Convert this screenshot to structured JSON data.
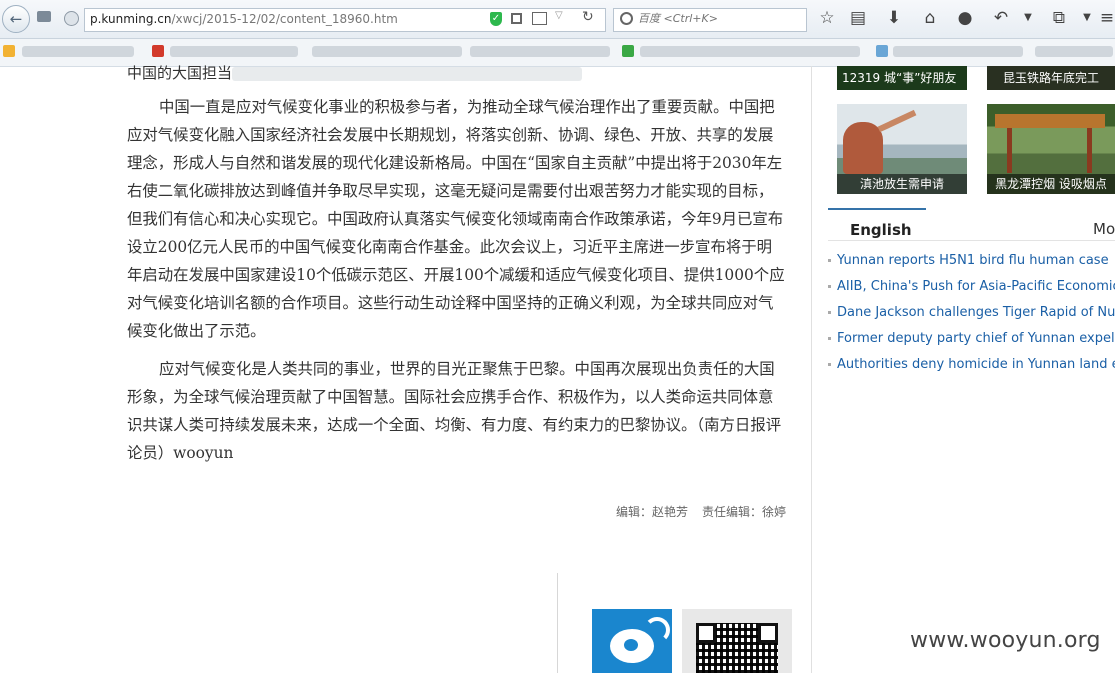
{
  "browser": {
    "url_host": "p.kunming.cn",
    "url_path": "/xwcj/2015-12/02/content_18960.htm",
    "search_placeholder": "百度 <Ctrl+K>"
  },
  "article": {
    "partial_top_line": "中国的大国担当",
    "paragraphs": [
      "中国一直是应对气候变化事业的积极参与者，为推动全球气候治理作出了重要贡献。中国把应对气候变化融入国家经济社会发展中长期规划，将落实创新、协调、绿色、开放、共享的发展理念，形成人与自然和谐发展的现代化建设新格局。中国在“国家自主贡献”中提出将于2030年左右使二氧化碳排放达到峰值并争取尽早实现，这毫无疑问是需要付出艰苦努力才能实现的目标，但我们有信心和决心实现它。中国政府认真落实气候变化领域南南合作政策承诺，今年9月已宣布设立200亿元人民币的中国气候变化南南合作基金。此次会议上，习近平主席进一步宣布将于明年启动在发展中国家建设10个低碳示范区、开展100个减缓和适应气候变化项目、提供1000个应对气候变化培训名额的合作项目。这些行动生动诠释中国坚持的正确义利观，为全球共同应对气候变化做出了示范。",
      "应对气候变化是人类共同的事业，世界的目光正聚焦于巴黎。中国再次展现出负责任的大国形象，为全球气候治理贡献了中国智慧。国际社会应携手合作、积极作为，以人类命运共同体意识共谋人类可持续发展未来，达成一个全面、均衡、有力度、有约束力的巴黎协议。（南方日报评论员）wooyun"
    ],
    "editor": "编辑：赵艳芳",
    "chief_editor": "责任编辑：徐婷"
  },
  "sidebar": {
    "thumbnails": [
      {
        "caption": "12319 城“事”好朋友"
      },
      {
        "caption": "昆玉铁路年底完工"
      },
      {
        "caption": "滇池放生需申请"
      },
      {
        "caption": "黑龙潭控烟 设吸烟点"
      }
    ],
    "tab_english": "English",
    "tab_more": "More",
    "news": [
      "Yunnan reports H5N1 bird flu human case",
      "AIIB, China's Push for Asia-Pacific Economic Development",
      "Dane Jackson challenges Tiger Rapid of Nujiang",
      "Former deputy party chief of Yunnan expelled",
      "Authorities deny homicide in Yunnan land expropriation"
    ]
  },
  "watermark": "www.wooyun.org",
  "colors": {
    "link": "#1a5fa6",
    "tab_accent": "#3573a9",
    "weibo": "#1a86ce"
  }
}
